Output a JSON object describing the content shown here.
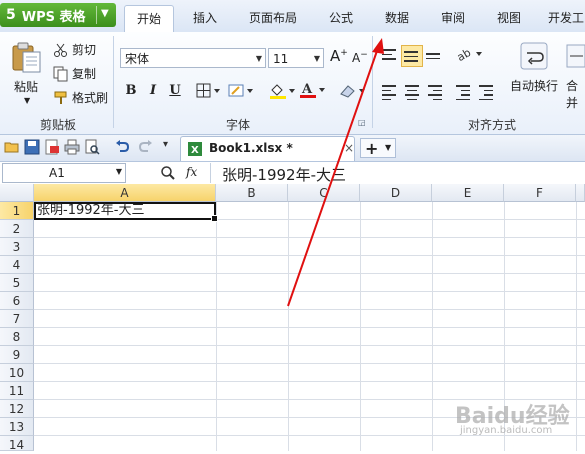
{
  "app": {
    "logo_glyph": "5",
    "menu_label": "WPS 表格"
  },
  "tabs": [
    "开始",
    "插入",
    "页面布局",
    "公式",
    "数据",
    "审阅",
    "视图",
    "开发工"
  ],
  "active_tab": "开始",
  "ribbon": {
    "clipboard": {
      "paste": "粘贴",
      "cut": "剪切",
      "copy": "复制",
      "format_painter": "格式刷",
      "group_label": "剪贴板"
    },
    "font": {
      "font_name": "宋体",
      "font_size": "11",
      "bold": "B",
      "italic": "I",
      "underline": "U",
      "grow": "A",
      "shrink": "A",
      "group_label": "字体"
    },
    "alignment": {
      "wrap_text": "自动换行",
      "merge": "合并",
      "group_label": "对齐方式"
    }
  },
  "document": {
    "tab_name": "Book1.xlsx *",
    "close_glyph": "×",
    "new_tab_glyph": "+"
  },
  "formula_bar": {
    "cell_ref": "A1",
    "fx_label": "fx",
    "content": "张明-1992年-大三"
  },
  "sheet": {
    "columns": [
      "A",
      "B",
      "C",
      "D",
      "E",
      "F"
    ],
    "rows": [
      "1",
      "2",
      "3",
      "4",
      "5",
      "6",
      "7",
      "8",
      "9",
      "10",
      "11",
      "12",
      "13",
      "14"
    ],
    "selected_cell": "A1",
    "cells": {
      "A1": "张明-1992年-大三"
    }
  },
  "watermark": {
    "brand": "Baidu经验",
    "sub": "jingyan.baidu.com"
  },
  "colors": {
    "wps_green": "#4aa02a",
    "annotation_red": "#e01010",
    "selection_header": "#f7d36b"
  }
}
